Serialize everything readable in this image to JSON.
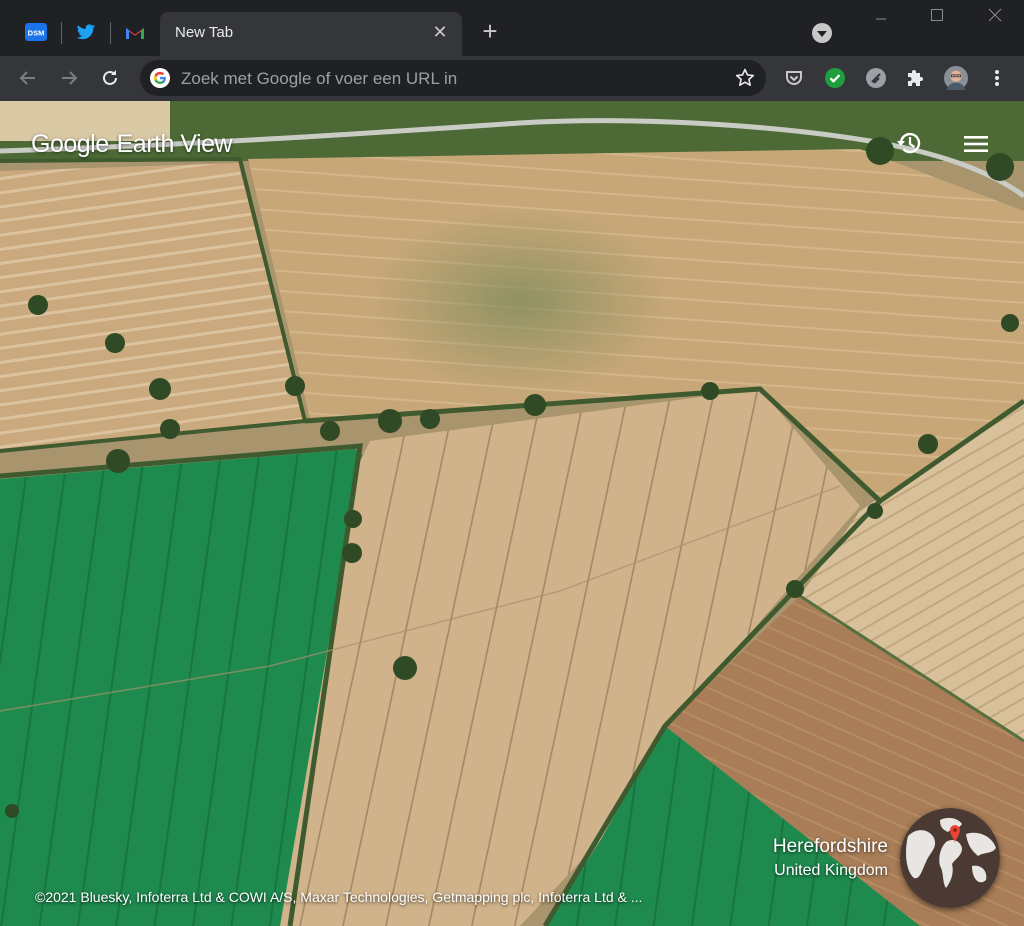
{
  "window": {
    "pinned_tabs": [
      {
        "name": "DSM",
        "icon": "dsm-favicon",
        "color": "#1a73e8"
      },
      {
        "name": "Twitter",
        "icon": "twitter-icon",
        "color": "#1da1f2"
      },
      {
        "name": "Gmail",
        "icon": "gmail-icon",
        "color": "#ea4335"
      }
    ],
    "active_tab": {
      "title": "New Tab",
      "close_icon": "close-icon"
    },
    "new_tab_icon": "plus-icon",
    "controls": {
      "minimize": "—",
      "maximize": "☐",
      "close": "✕"
    }
  },
  "toolbar": {
    "omnibox_placeholder": "Zoek met Google of voer een URL in",
    "extensions": [
      "pocket-icon",
      "check-shield-icon",
      "feedly-icon",
      "puzzle-icon",
      "avatar",
      "kebab-menu-icon"
    ]
  },
  "earthview": {
    "brand": "Google",
    "product": "Earth View",
    "location_region": "Herefordshire",
    "location_country": "United Kingdom",
    "attribution": "©2021 Bluesky, Infoterra Ltd & COWI A/S, Maxar Technologies, Getmapping plc, Infoterra Ltd & ..."
  },
  "colors": {
    "chrome_dark": "#202124",
    "toolbar": "#35363a",
    "field_wheat": "#c9a77a",
    "field_green": "#1f8a4f",
    "pin_red": "#ea4335"
  }
}
